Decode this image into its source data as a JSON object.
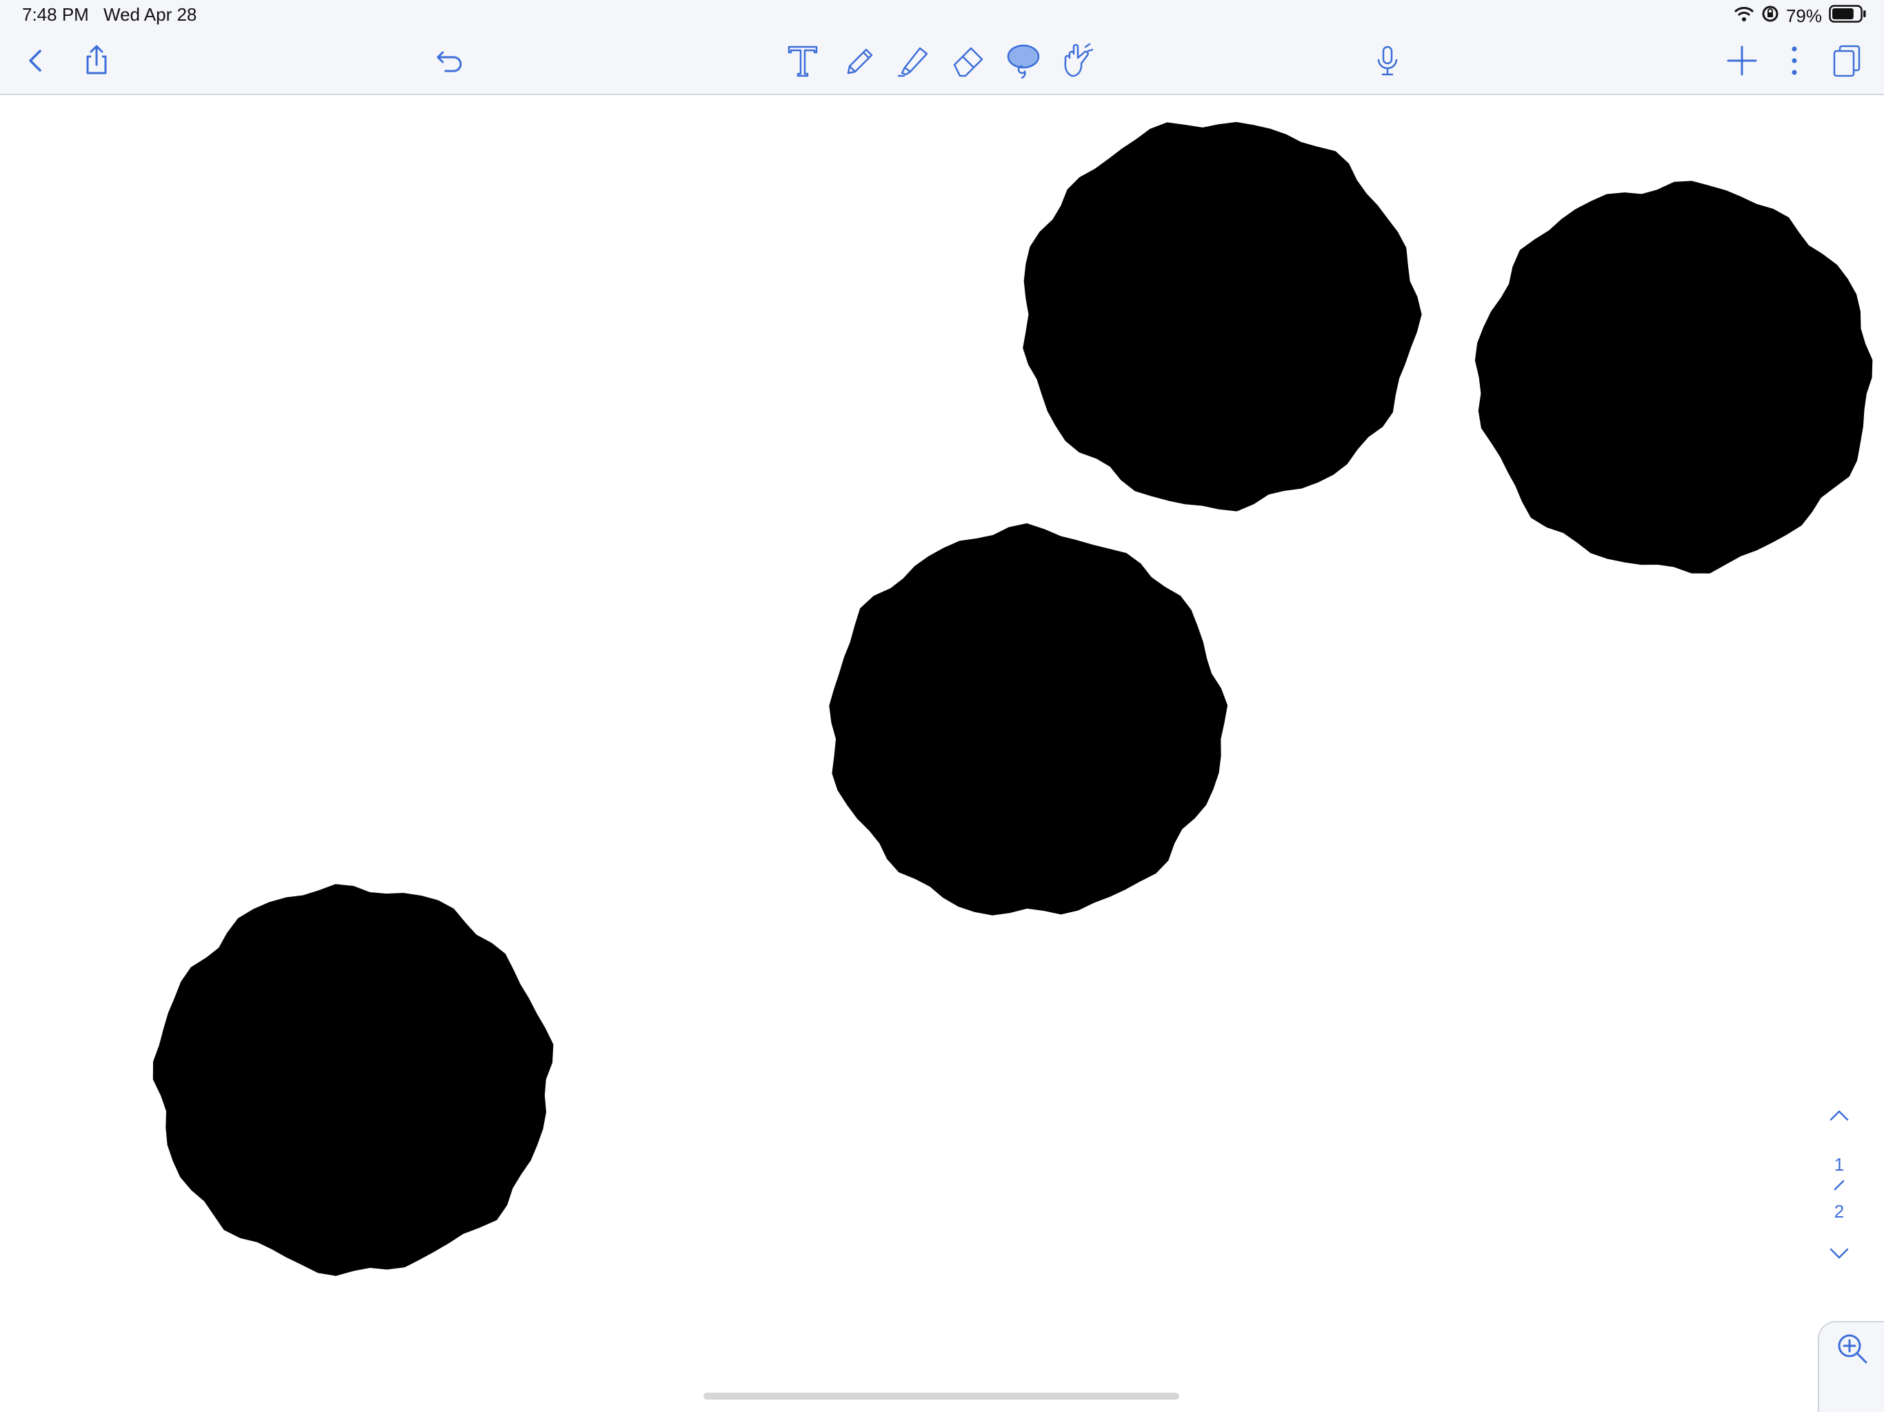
{
  "status_bar": {
    "time": "7:48 PM",
    "date": "Wed Apr 28",
    "battery_percent": "79%",
    "battery_level": 0.79
  },
  "toolbar": {
    "left": [
      "back-icon",
      "share-icon",
      "undo-icon"
    ],
    "tools": [
      "text-tool-icon",
      "pen-tool-icon",
      "highlighter-tool-icon",
      "eraser-tool-icon",
      "lasso-tool-icon",
      "hand-pointer-tool-icon"
    ],
    "selected_tool": "lasso-tool-icon",
    "right": [
      "microphone-icon",
      "add-page-icon",
      "more-icon",
      "pages-icon"
    ],
    "accent_color": "#3d6fd8"
  },
  "canvas": {
    "background": "#ffffff",
    "ink_color": "#000000",
    "blob_count": 4
  },
  "page_nav": {
    "current": "1",
    "total": "2"
  },
  "zoom_icon": "zoom-in-icon"
}
